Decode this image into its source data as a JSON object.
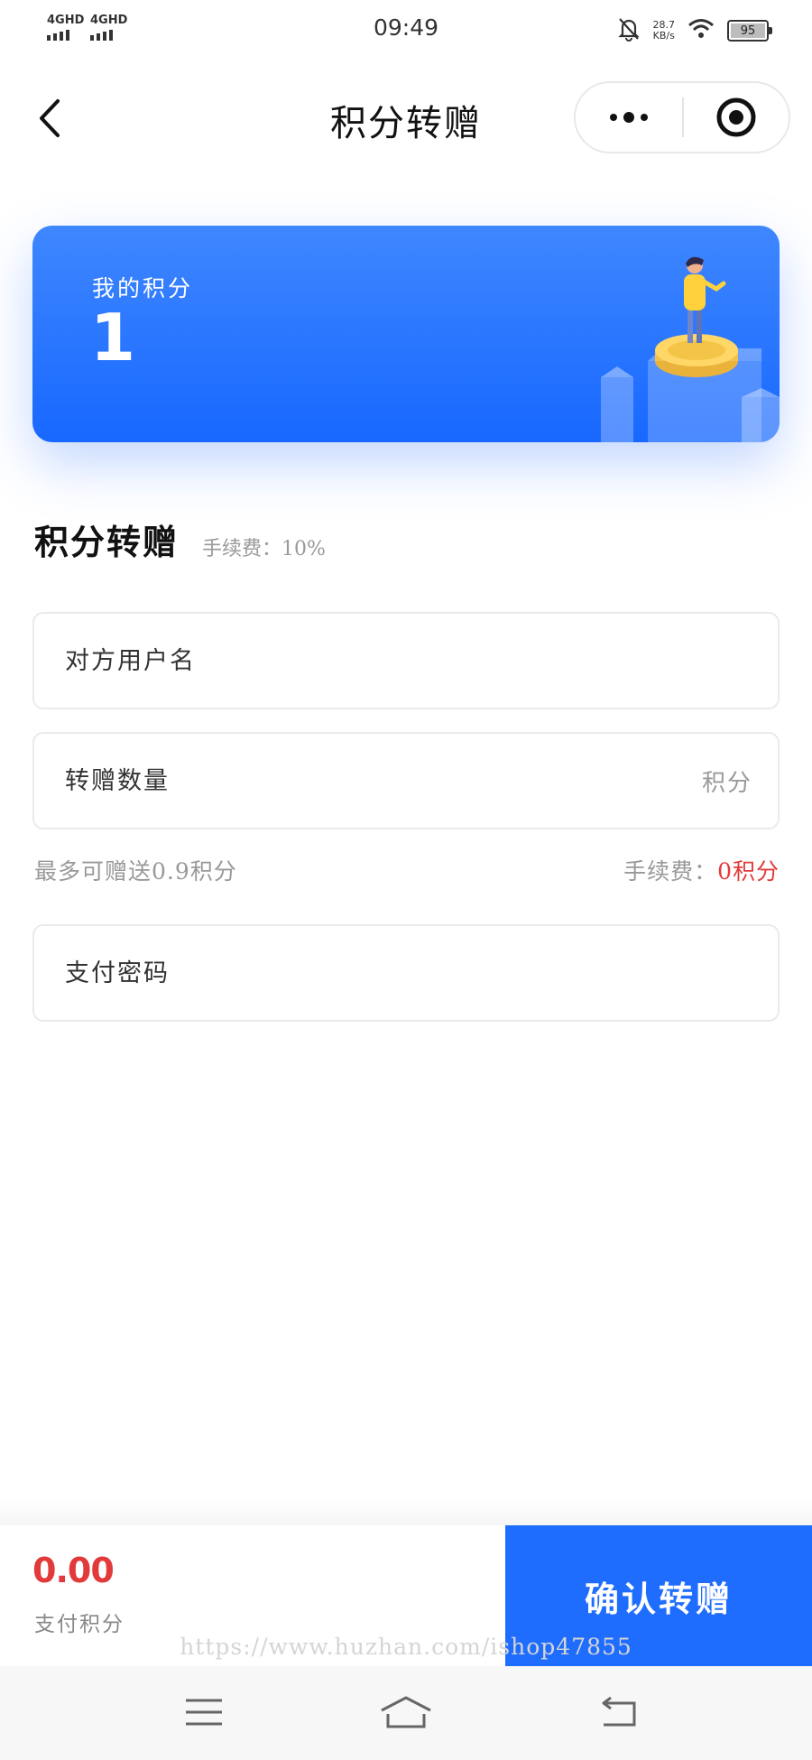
{
  "status_bar": {
    "signal1": "4GHD",
    "signal2": "4GHD",
    "time": "09:49",
    "speed_value": "28.7",
    "speed_unit": "KB/s",
    "battery": "95"
  },
  "nav": {
    "title": "积分转赠"
  },
  "points_card": {
    "label": "我的积分",
    "value": "1"
  },
  "section": {
    "title": "积分转赠",
    "fee": "手续费：10%"
  },
  "form": {
    "username_placeholder": "对方用户名",
    "amount_placeholder": "转赠数量",
    "amount_suffix": "积分",
    "password_placeholder": "支付密码"
  },
  "hints": {
    "max_amount": "最多可赠送0.9积分",
    "fee_label": "手续费：",
    "fee_value": "0积分"
  },
  "bottom": {
    "pay_amount": "0.00",
    "pay_label": "支付积分",
    "confirm_label": "确认转赠",
    "watermark": "https://www.huzhan.com/ishop47855"
  },
  "colors": {
    "accent": "#1f6dff",
    "card_top": "#3f87ff",
    "card_bottom": "#1868ff",
    "danger": "#e23a3a"
  },
  "icons": {
    "back": "chevron-left-icon",
    "more": "more-dots-icon",
    "target": "target-icon",
    "menu": "menu-icon",
    "home": "home-icon",
    "return": "return-icon",
    "alarm_off": "bell-off-icon",
    "wifi": "wifi-icon",
    "battery": "battery-icon"
  }
}
